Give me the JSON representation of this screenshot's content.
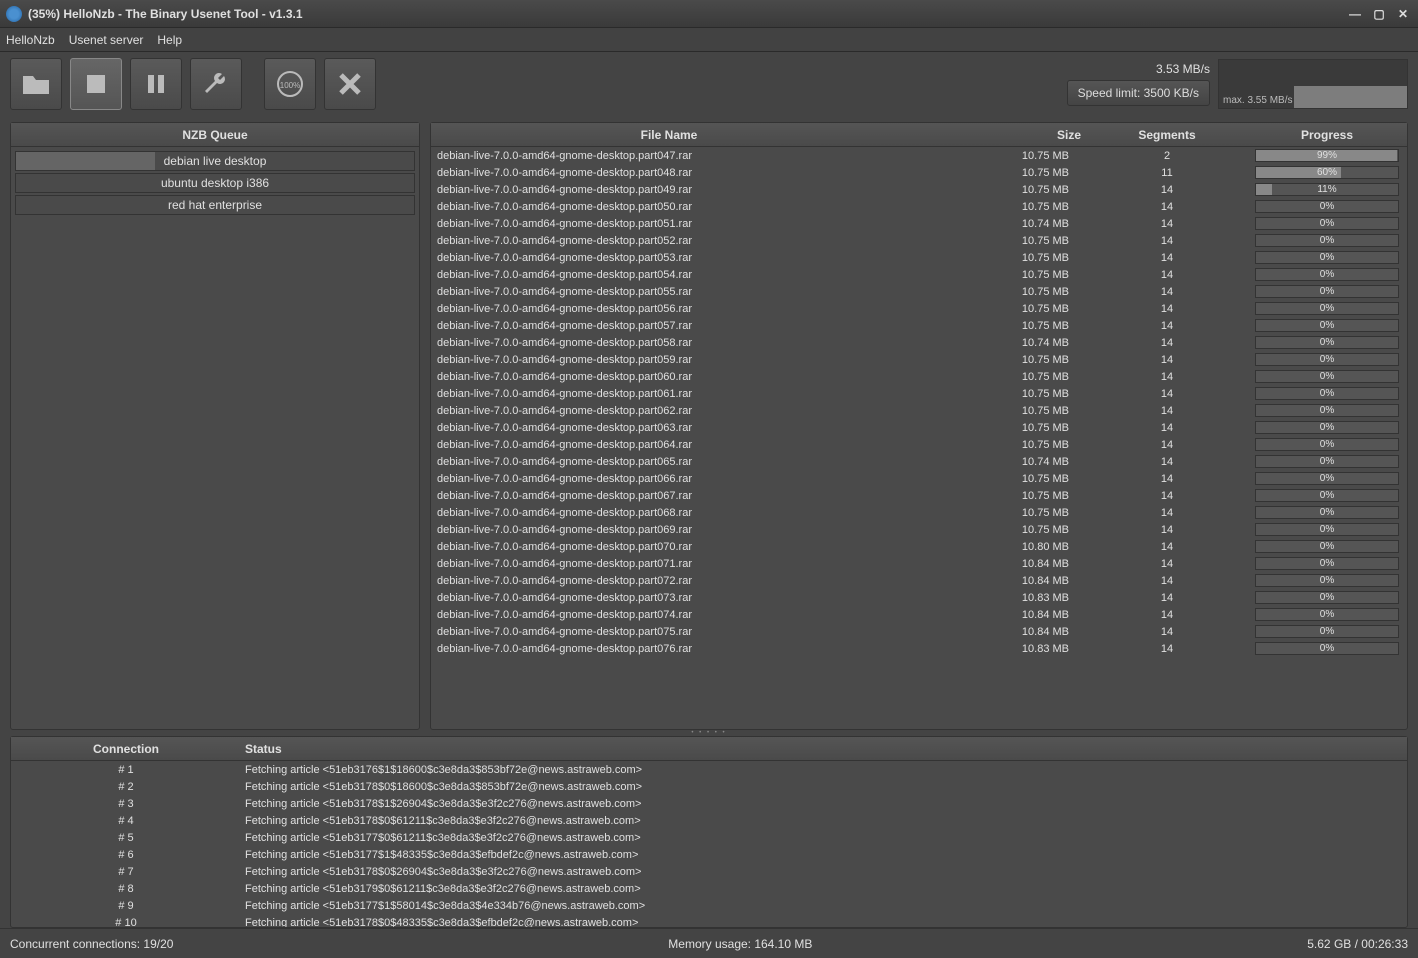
{
  "window": {
    "title": "(35%) HelloNzb - The Binary Usenet Tool - v1.3.1"
  },
  "menu": [
    "HelloNzb",
    "Usenet server",
    "Help"
  ],
  "toolbar": {
    "open": "open-folder-icon",
    "stop": "stop-icon",
    "pause": "pause-icon",
    "settings": "wrench-icon",
    "speed": "gauge-icon",
    "cancel": "x-icon"
  },
  "speed": {
    "current": "3.53 MB/s",
    "limit_label": "Speed limit: 3500 KB/s",
    "graph_max": "max. 3.55 MB/s"
  },
  "queue": {
    "header": "NZB Queue",
    "items": [
      {
        "label": "debian live desktop",
        "progress": 35
      },
      {
        "label": "ubuntu desktop i386",
        "progress": 0
      },
      {
        "label": "red hat enterprise",
        "progress": 0
      }
    ]
  },
  "files": {
    "columns": [
      "File Name",
      "Size",
      "Segments",
      "Progress"
    ],
    "rows": [
      {
        "name": "debian-live-7.0.0-amd64-gnome-desktop.part047.rar",
        "size": "10.75 MB",
        "seg": "2",
        "prog": 99
      },
      {
        "name": "debian-live-7.0.0-amd64-gnome-desktop.part048.rar",
        "size": "10.75 MB",
        "seg": "11",
        "prog": 60
      },
      {
        "name": "debian-live-7.0.0-amd64-gnome-desktop.part049.rar",
        "size": "10.75 MB",
        "seg": "14",
        "prog": 11
      },
      {
        "name": "debian-live-7.0.0-amd64-gnome-desktop.part050.rar",
        "size": "10.75 MB",
        "seg": "14",
        "prog": 0
      },
      {
        "name": "debian-live-7.0.0-amd64-gnome-desktop.part051.rar",
        "size": "10.74 MB",
        "seg": "14",
        "prog": 0
      },
      {
        "name": "debian-live-7.0.0-amd64-gnome-desktop.part052.rar",
        "size": "10.75 MB",
        "seg": "14",
        "prog": 0
      },
      {
        "name": "debian-live-7.0.0-amd64-gnome-desktop.part053.rar",
        "size": "10.75 MB",
        "seg": "14",
        "prog": 0
      },
      {
        "name": "debian-live-7.0.0-amd64-gnome-desktop.part054.rar",
        "size": "10.75 MB",
        "seg": "14",
        "prog": 0
      },
      {
        "name": "debian-live-7.0.0-amd64-gnome-desktop.part055.rar",
        "size": "10.75 MB",
        "seg": "14",
        "prog": 0
      },
      {
        "name": "debian-live-7.0.0-amd64-gnome-desktop.part056.rar",
        "size": "10.75 MB",
        "seg": "14",
        "prog": 0
      },
      {
        "name": "debian-live-7.0.0-amd64-gnome-desktop.part057.rar",
        "size": "10.75 MB",
        "seg": "14",
        "prog": 0
      },
      {
        "name": "debian-live-7.0.0-amd64-gnome-desktop.part058.rar",
        "size": "10.74 MB",
        "seg": "14",
        "prog": 0
      },
      {
        "name": "debian-live-7.0.0-amd64-gnome-desktop.part059.rar",
        "size": "10.75 MB",
        "seg": "14",
        "prog": 0
      },
      {
        "name": "debian-live-7.0.0-amd64-gnome-desktop.part060.rar",
        "size": "10.75 MB",
        "seg": "14",
        "prog": 0
      },
      {
        "name": "debian-live-7.0.0-amd64-gnome-desktop.part061.rar",
        "size": "10.75 MB",
        "seg": "14",
        "prog": 0
      },
      {
        "name": "debian-live-7.0.0-amd64-gnome-desktop.part062.rar",
        "size": "10.75 MB",
        "seg": "14",
        "prog": 0
      },
      {
        "name": "debian-live-7.0.0-amd64-gnome-desktop.part063.rar",
        "size": "10.75 MB",
        "seg": "14",
        "prog": 0
      },
      {
        "name": "debian-live-7.0.0-amd64-gnome-desktop.part064.rar",
        "size": "10.75 MB",
        "seg": "14",
        "prog": 0
      },
      {
        "name": "debian-live-7.0.0-amd64-gnome-desktop.part065.rar",
        "size": "10.74 MB",
        "seg": "14",
        "prog": 0
      },
      {
        "name": "debian-live-7.0.0-amd64-gnome-desktop.part066.rar",
        "size": "10.75 MB",
        "seg": "14",
        "prog": 0
      },
      {
        "name": "debian-live-7.0.0-amd64-gnome-desktop.part067.rar",
        "size": "10.75 MB",
        "seg": "14",
        "prog": 0
      },
      {
        "name": "debian-live-7.0.0-amd64-gnome-desktop.part068.rar",
        "size": "10.75 MB",
        "seg": "14",
        "prog": 0
      },
      {
        "name": "debian-live-7.0.0-amd64-gnome-desktop.part069.rar",
        "size": "10.75 MB",
        "seg": "14",
        "prog": 0
      },
      {
        "name": "debian-live-7.0.0-amd64-gnome-desktop.part070.rar",
        "size": "10.80 MB",
        "seg": "14",
        "prog": 0
      },
      {
        "name": "debian-live-7.0.0-amd64-gnome-desktop.part071.rar",
        "size": "10.84 MB",
        "seg": "14",
        "prog": 0
      },
      {
        "name": "debian-live-7.0.0-amd64-gnome-desktop.part072.rar",
        "size": "10.84 MB",
        "seg": "14",
        "prog": 0
      },
      {
        "name": "debian-live-7.0.0-amd64-gnome-desktop.part073.rar",
        "size": "10.83 MB",
        "seg": "14",
        "prog": 0
      },
      {
        "name": "debian-live-7.0.0-amd64-gnome-desktop.part074.rar",
        "size": "10.84 MB",
        "seg": "14",
        "prog": 0
      },
      {
        "name": "debian-live-7.0.0-amd64-gnome-desktop.part075.rar",
        "size": "10.84 MB",
        "seg": "14",
        "prog": 0
      },
      {
        "name": "debian-live-7.0.0-amd64-gnome-desktop.part076.rar",
        "size": "10.83 MB",
        "seg": "14",
        "prog": 0
      }
    ]
  },
  "connections": {
    "columns": [
      "Connection",
      "Status"
    ],
    "rows": [
      {
        "num": "# 1",
        "status": "Fetching article <51eb3176$1$18600$c3e8da3$853bf72e@news.astraweb.com>"
      },
      {
        "num": "# 2",
        "status": "Fetching article <51eb3178$0$18600$c3e8da3$853bf72e@news.astraweb.com>"
      },
      {
        "num": "# 3",
        "status": "Fetching article <51eb3178$1$26904$c3e8da3$e3f2c276@news.astraweb.com>"
      },
      {
        "num": "# 4",
        "status": "Fetching article <51eb3178$0$61211$c3e8da3$e3f2c276@news.astraweb.com>"
      },
      {
        "num": "# 5",
        "status": "Fetching article <51eb3177$0$61211$c3e8da3$e3f2c276@news.astraweb.com>"
      },
      {
        "num": "# 6",
        "status": "Fetching article <51eb3177$1$48335$c3e8da3$efbdef2c@news.astraweb.com>"
      },
      {
        "num": "# 7",
        "status": "Fetching article <51eb3178$0$26904$c3e8da3$e3f2c276@news.astraweb.com>"
      },
      {
        "num": "# 8",
        "status": "Fetching article <51eb3179$0$61211$c3e8da3$e3f2c276@news.astraweb.com>"
      },
      {
        "num": "# 9",
        "status": "Fetching article <51eb3177$1$58014$c3e8da3$4e334b76@news.astraweb.com>"
      },
      {
        "num": "# 10",
        "status": "Fetching article <51eb3178$0$48335$c3e8da3$efbdef2c@news.astraweb.com>"
      }
    ]
  },
  "status": {
    "connections": "Concurrent connections: 19/20",
    "memory": "Memory usage: 164.10 MB",
    "total": "5.62 GB / 00:26:33"
  }
}
